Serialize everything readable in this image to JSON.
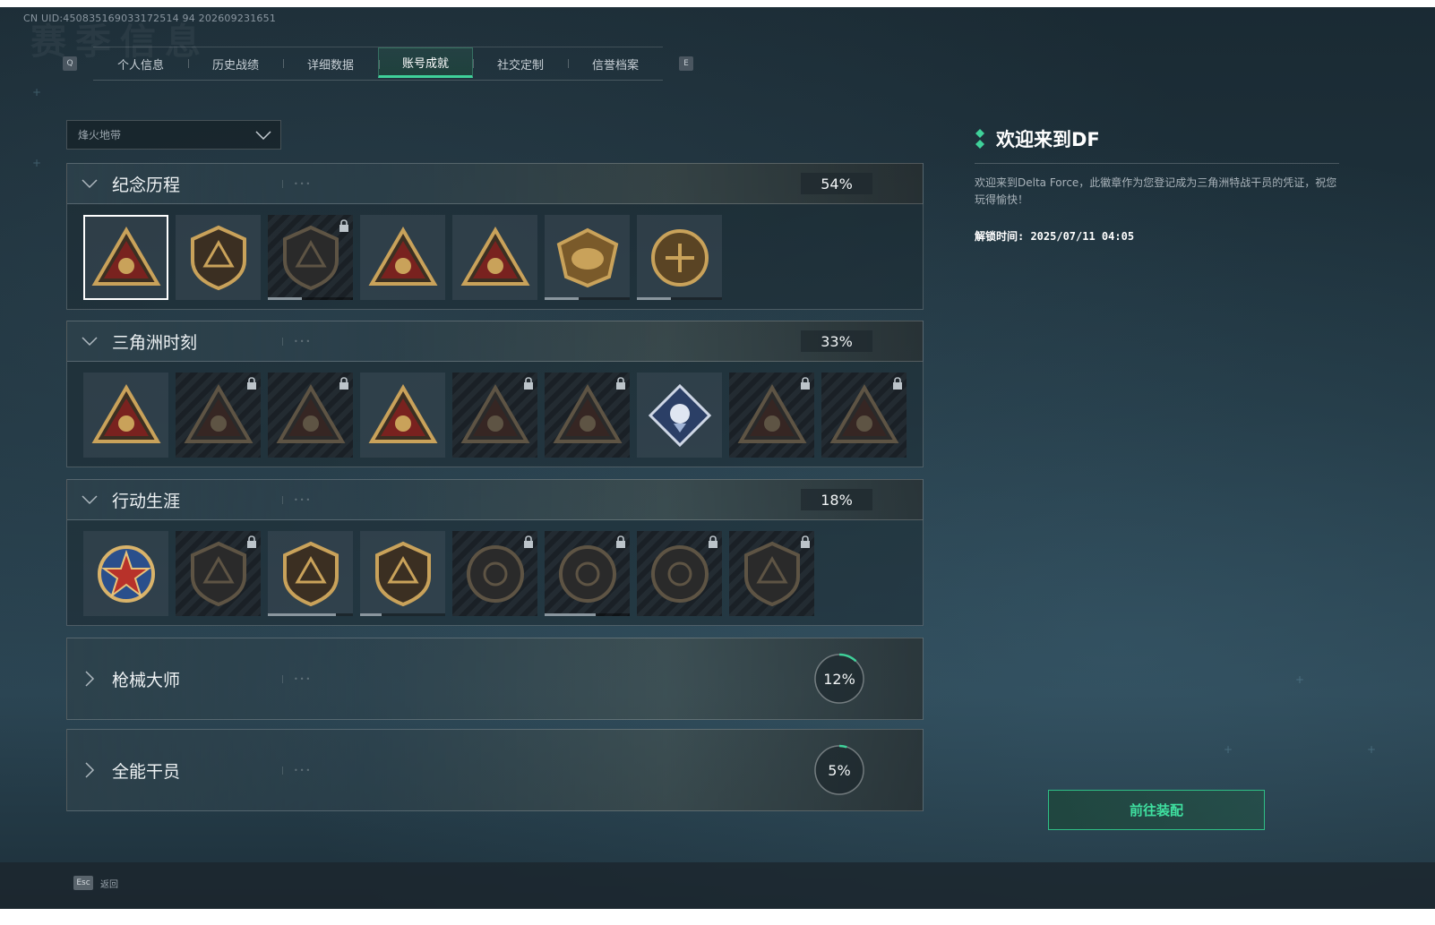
{
  "uid": "CN UID:450835169033172514 94 202609231651",
  "bg_title": "赛季信息",
  "tabs": {
    "left_key": "Q",
    "right_key": "E",
    "items": [
      {
        "label": "个人信息",
        "active": false
      },
      {
        "label": "历史战绩",
        "active": false
      },
      {
        "label": "详细数据",
        "active": false
      },
      {
        "label": "账号成就",
        "active": true
      },
      {
        "label": "社交定制",
        "active": false
      },
      {
        "label": "信誉档案",
        "active": false
      }
    ]
  },
  "mode_select": {
    "value": "烽火地带"
  },
  "sections": [
    {
      "title": "纪念历程",
      "percent": "54%",
      "percent_value": 54,
      "expanded": true,
      "badges": [
        {
          "icon": "delta-triangle-shield-badge",
          "locked": false,
          "selected": true,
          "progress": null
        },
        {
          "icon": "helicopter-badge",
          "locked": false,
          "selected": false,
          "progress": null
        },
        {
          "icon": "dark-shield-badge",
          "locked": true,
          "selected": false,
          "progress": 0.4
        },
        {
          "icon": "rank-1-triangle-badge",
          "locked": false,
          "selected": false,
          "progress": null
        },
        {
          "icon": "rank-2-triangle-badge",
          "locked": false,
          "selected": false,
          "progress": null
        },
        {
          "icon": "delta-force-eagle-badge",
          "locked": false,
          "selected": false,
          "progress": 0.4
        },
        {
          "icon": "delta-force-2026-badge",
          "locked": false,
          "selected": false,
          "progress": 0.4
        }
      ]
    },
    {
      "title": "三角洲时刻",
      "percent": "33%",
      "percent_value": 33,
      "expanded": true,
      "badges": [
        {
          "icon": "supply-crate-triangle-badge",
          "locked": false
        },
        {
          "icon": "operator-triangle-badge",
          "locked": true
        },
        {
          "icon": "emblem-triangle-badge",
          "locked": true
        },
        {
          "icon": "squad-triangle-badge",
          "locked": false
        },
        {
          "icon": "team-triangle-badge",
          "locked": true
        },
        {
          "icon": "beast-triangle-badge",
          "locked": true
        },
        {
          "icon": "rose-diamond-badge",
          "locked": false
        },
        {
          "icon": "skull-triangle-badge",
          "locked": true
        },
        {
          "icon": "headset-triangle-badge",
          "locked": true
        }
      ]
    },
    {
      "title": "行动生涯",
      "percent": "18%",
      "percent_value": 18,
      "expanded": true,
      "badges": [
        {
          "icon": "star-medal-badge",
          "locked": false,
          "progress": null
        },
        {
          "icon": "shield-emblem-badge",
          "locked": true,
          "progress": null
        },
        {
          "icon": "crest-shield-badge",
          "locked": false,
          "progress": 0.8
        },
        {
          "icon": "gem-shield-badge",
          "locked": false,
          "progress": 0.25
        },
        {
          "icon": "round-emblem-badge",
          "locked": true,
          "progress": null
        },
        {
          "icon": "skull-crosshair-badge",
          "locked": true,
          "progress": 0.6
        },
        {
          "icon": "eye-emblem-badge",
          "locked": true,
          "progress": null
        },
        {
          "icon": "eagle-emblem-badge",
          "locked": true,
          "progress": null
        }
      ]
    },
    {
      "title": "枪械大师",
      "percent": "12%",
      "percent_value": 12,
      "expanded": false
    },
    {
      "title": "全能干员",
      "percent": "5%",
      "percent_value": 5,
      "expanded": false
    }
  ],
  "detail": {
    "title": "欢迎来到DF",
    "description": "欢迎来到Delta Force，此徽章作为您登记成为三角洲特战干员的凭证，祝您玩得愉快！",
    "unlock_time": "解锁时间: 2025/07/11 04:05"
  },
  "equip_button": "前往装配",
  "footer": {
    "esc_key": "Esc",
    "back_label": "返回"
  },
  "colors": {
    "accent": "#3fd19a",
    "gold": "#c9a25a",
    "red": "#8a1f1f"
  }
}
